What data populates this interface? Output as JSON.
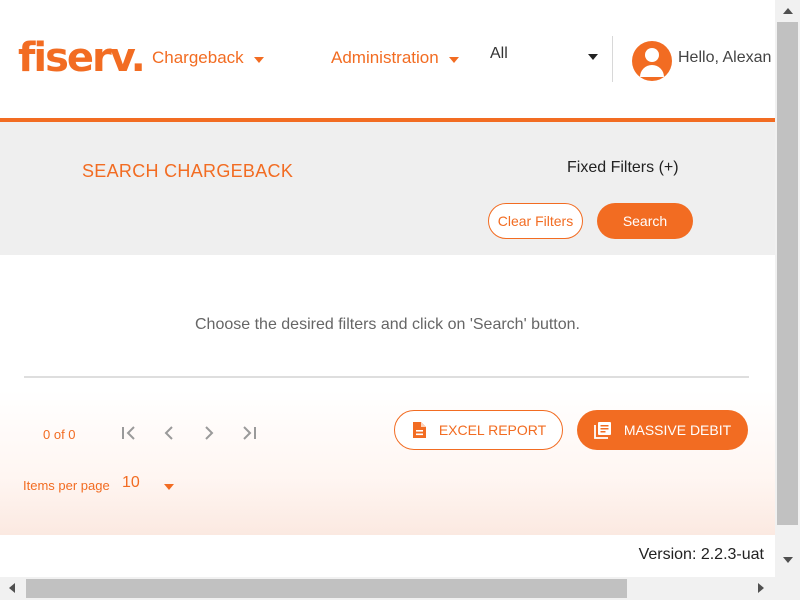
{
  "header": {
    "logo_text": "fiserv.",
    "nav": [
      {
        "label": "Chargeback"
      },
      {
        "label": "Administration"
      }
    ],
    "entity_select": {
      "value": "All"
    },
    "greeting": "Hello, Alexan"
  },
  "filters": {
    "title": "SEARCH CHARGEBACK",
    "fixed_filters_label": "Fixed Filters (+)",
    "clear_label": "Clear Filters",
    "search_label": "Search"
  },
  "results": {
    "empty_message": "Choose the desired filters and click on 'Search' button."
  },
  "paginator": {
    "range_label": "0 of 0",
    "items_per_page_label": "Items per page",
    "items_per_page_value": "10"
  },
  "actions": {
    "excel_label": "EXCEL REPORT",
    "massive_label": "MASSIVE DEBIT"
  },
  "footer": {
    "version": "Version: 2.2.3-uat"
  },
  "colors": {
    "accent": "#f26c22",
    "band": "#efefef"
  }
}
